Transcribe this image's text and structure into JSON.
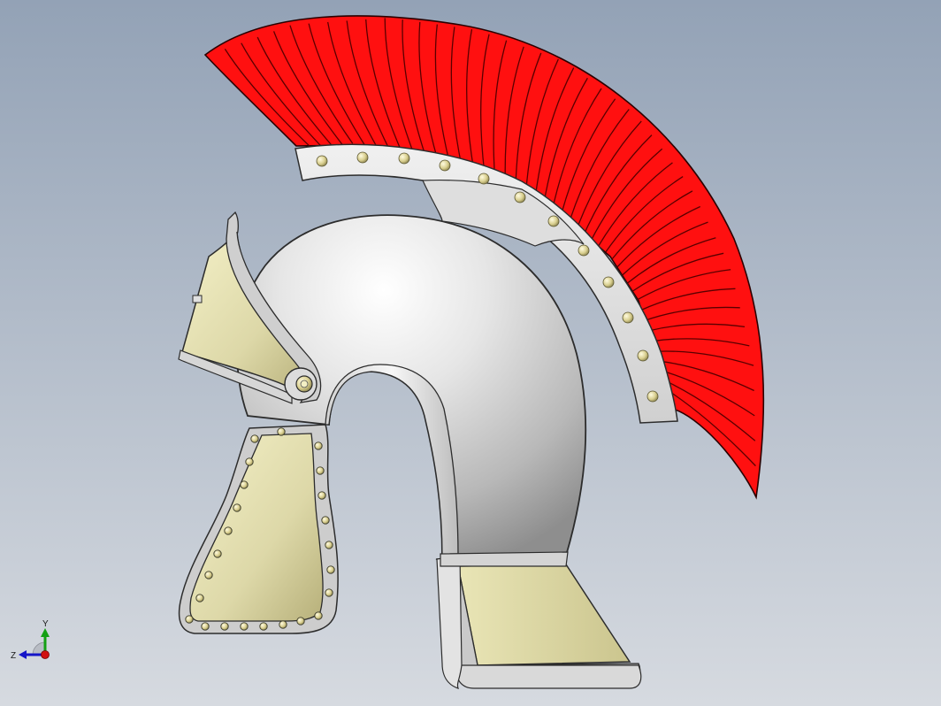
{
  "viewport": {
    "background_top": "#93a2b6",
    "background_bottom": "#d6dae0"
  },
  "model": {
    "name": "roman-helmet",
    "colors": {
      "crest": "#ff0f0f",
      "crest_dark": "#7a0000",
      "metal_light": "#ffffff",
      "metal_mid": "#cfcfcf",
      "metal_dark": "#8a8a8a",
      "brass_light": "#f4f1c8",
      "brass_mid": "#d8d3a1",
      "brass_dark": "#a8a26a",
      "rivet": "#d9cf8f",
      "edge": "#2c2c2c"
    }
  },
  "triad": {
    "x_color": "#d11111",
    "y_color": "#14a014",
    "z_color": "#1515c8",
    "y_label": "Y",
    "z_label": "Z"
  }
}
